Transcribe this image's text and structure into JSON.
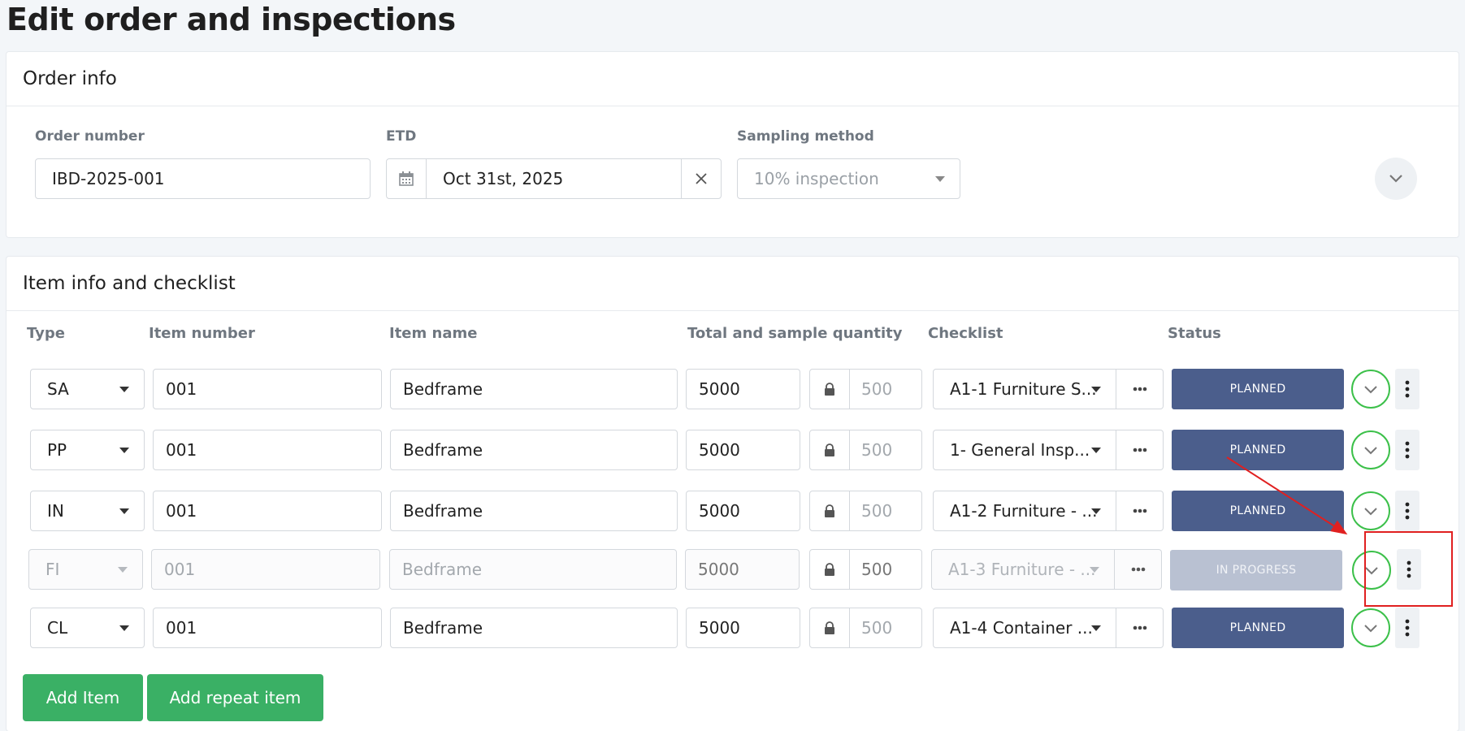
{
  "page": {
    "title": "Edit order and inspections"
  },
  "order_info": {
    "title": "Order info",
    "order_number": {
      "label": "Order number",
      "value": "IBD-2025-001"
    },
    "etd": {
      "label": "ETD",
      "value": "Oct 31st, 2025"
    },
    "sampling": {
      "label": "Sampling method",
      "placeholder": "10% inspection"
    }
  },
  "items_section": {
    "title": "Item info and checklist",
    "columns": [
      "Type",
      "Item number",
      "Item name",
      "Total and sample quantity",
      "Checklist",
      "Status"
    ],
    "rows": [
      {
        "type": "SA",
        "item_number": "001",
        "item_name": "Bedframe",
        "total": "5000",
        "sample": "500",
        "checklist": "A1-1 Furniture S...",
        "status": "PLANNED",
        "disabled": false
      },
      {
        "type": "PP",
        "item_number": "001",
        "item_name": "Bedframe",
        "total": "5000",
        "sample": "500",
        "checklist": "1- General Insp...",
        "status": "PLANNED",
        "disabled": false
      },
      {
        "type": "IN",
        "item_number": "001",
        "item_name": "Bedframe",
        "total": "5000",
        "sample": "500",
        "checklist": "A1-2 Furniture - ...",
        "status": "PLANNED",
        "disabled": false
      },
      {
        "type": "FI",
        "item_number": "001",
        "item_name": "Bedframe",
        "total": "5000",
        "sample": "500",
        "checklist": "A1-3 Furniture - ...",
        "status": "IN PROGRESS",
        "disabled": true
      },
      {
        "type": "CL",
        "item_number": "001",
        "item_name": "Bedframe",
        "total": "5000",
        "sample": "500",
        "checklist": "A1-4 Container ...",
        "status": "PLANNED",
        "disabled": false
      }
    ],
    "buttons": {
      "add_item": "Add Item",
      "add_repeat": "Add repeat item"
    }
  },
  "colors": {
    "status_planned": "#4b5e8c",
    "status_in_progress": "#b9c1d2",
    "accent_green": "#3ab065",
    "annotation_red": "#e02020"
  },
  "icons": {
    "calendar": "calendar-icon",
    "clear": "close-icon",
    "lock": "lock-icon",
    "more": "ellipsis-icon",
    "kebab": "kebab-icon",
    "expand": "chevron-down-icon"
  }
}
